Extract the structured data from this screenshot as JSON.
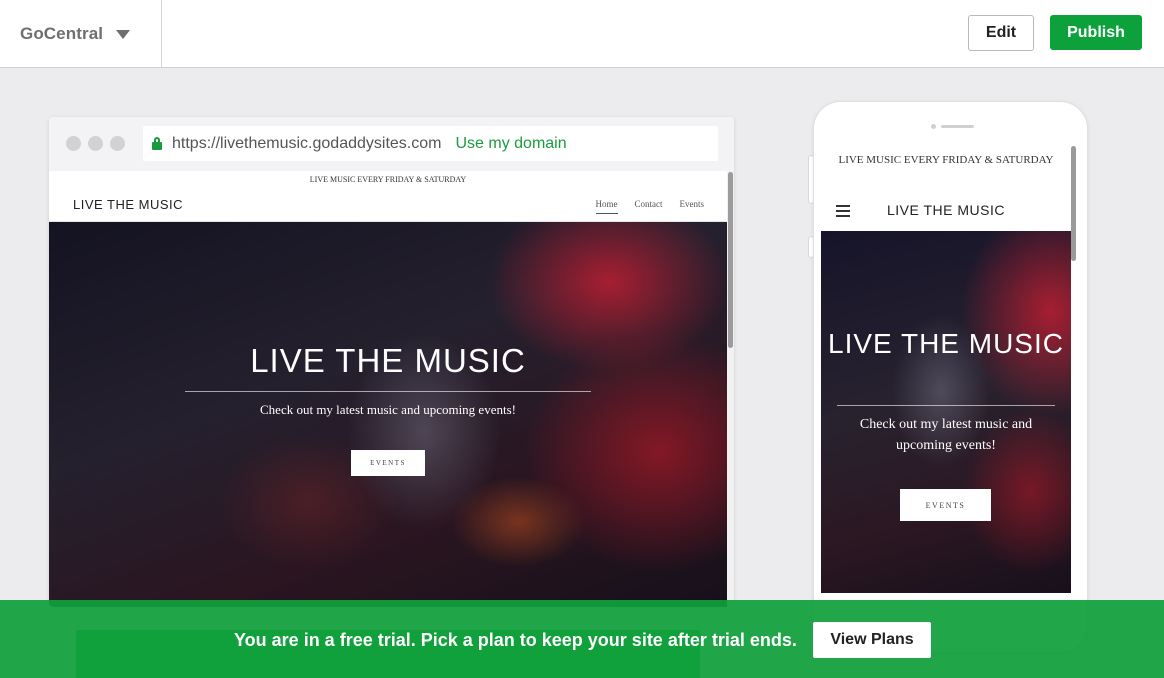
{
  "app": {
    "brand": "GoCentral"
  },
  "toolbar": {
    "edit_label": "Edit",
    "publish_label": "Publish"
  },
  "browser": {
    "url": "https://livethemusic.godaddysites.com",
    "use_domain_label": "Use my domain"
  },
  "site": {
    "announcement": "LIVE MUSIC EVERY FRIDAY & SATURDAY",
    "logo": "LIVE THE MUSIC",
    "nav": [
      "Home",
      "Contact",
      "Events"
    ],
    "nav_active": "Home",
    "hero": {
      "title": "LIVE THE MUSIC",
      "subtitle": "Check out my latest music and upcoming events!",
      "button_label": "EVENTS"
    }
  },
  "mobile": {
    "announcement": "LIVE MUSIC EVERY FRIDAY & SATURDAY",
    "logo": "LIVE THE MUSIC",
    "hero_title": "LIVE THE MUSIC",
    "hero_subtitle": "Check out my latest music and upcoming events!",
    "button_label": "EVENTS"
  },
  "banner": {
    "text": "You are in a free trial. Pick a plan to keep your site after trial ends.",
    "button_label": "View Plans"
  },
  "colors": {
    "brand_green": "#0da13c",
    "link_green": "#1a9c3e",
    "banner_green": "#10a03c",
    "canvas_gray": "#ececee"
  },
  "icons": [
    "chevron-down-icon",
    "lock-icon",
    "hamburger-menu-icon"
  ]
}
